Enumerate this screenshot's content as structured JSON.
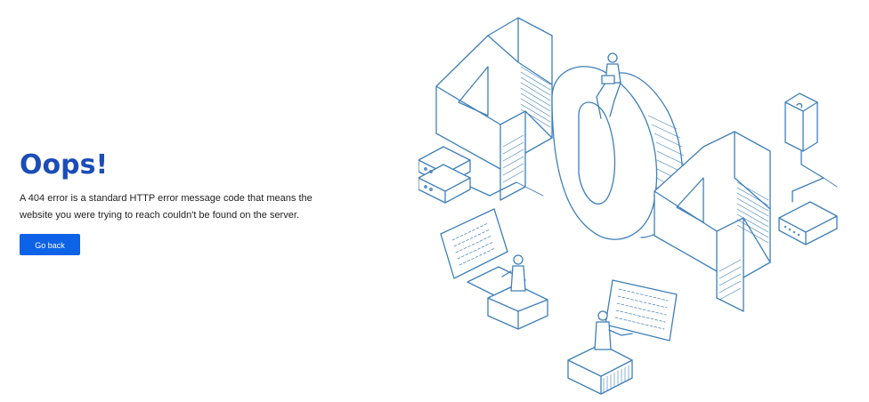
{
  "page": {
    "title": "Oops!",
    "message": "A 404 error is a standard HTTP error message code that means the website you were trying to reach couldn't be found on the server.",
    "back_button_label": "Go back"
  },
  "illustration": {
    "stroke_color": "#3f7fb8",
    "accent_color": "#0d62e6",
    "title_color": "#1b4db8"
  }
}
